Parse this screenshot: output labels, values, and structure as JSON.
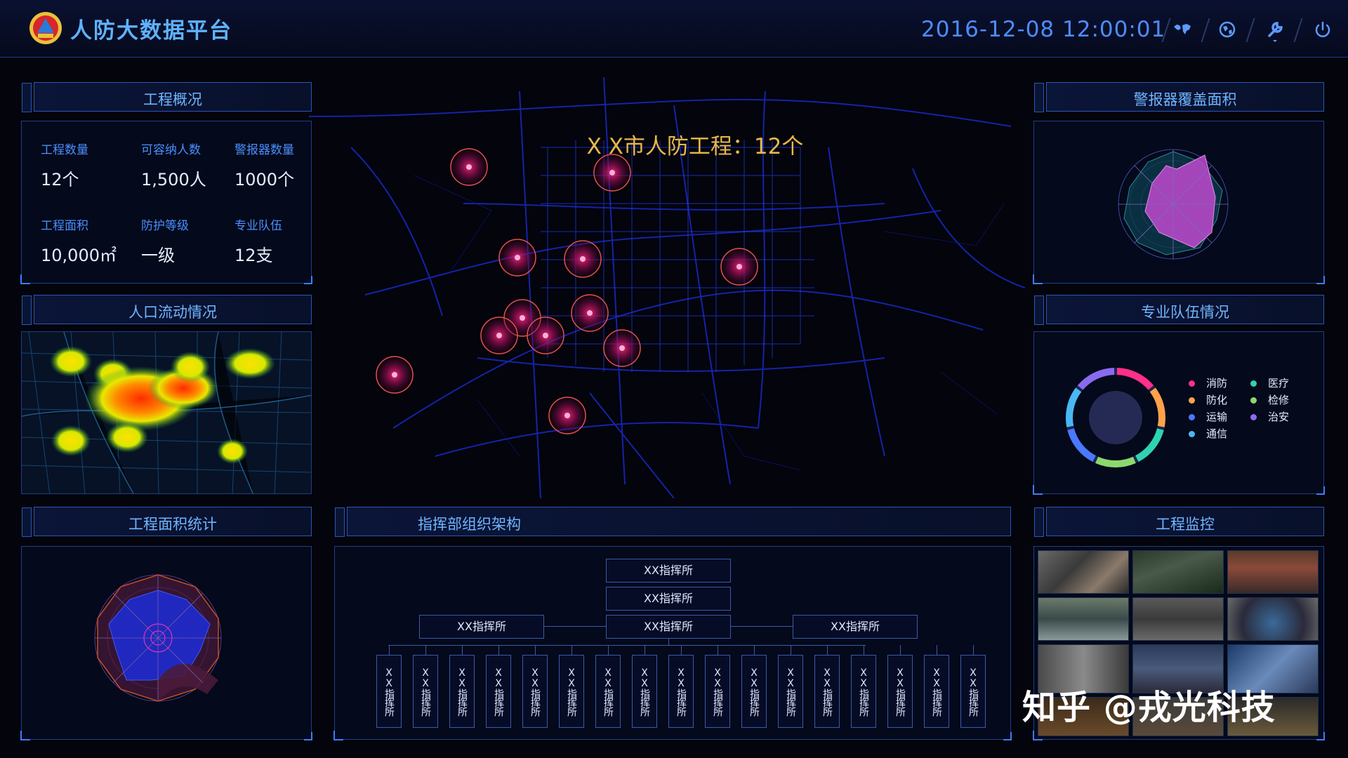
{
  "app": {
    "title": "人防大数据平台",
    "datetime": "2016-12-08 12:00:01",
    "accent_color": "#4d8cff",
    "toolbar_icons": [
      "world-map-icon",
      "globe-icon",
      "wrench-icon",
      "power-icon"
    ]
  },
  "overview": {
    "title": "工程概况",
    "stats": [
      {
        "label": "工程数量",
        "value": "12个"
      },
      {
        "label": "可容纳人数",
        "value": "1,500人"
      },
      {
        "label": "警报器数量",
        "value": "1000个"
      },
      {
        "label": "工程面积",
        "value": "10,000㎡"
      },
      {
        "label": "防护等级",
        "value": "一级"
      },
      {
        "label": "专业队伍",
        "value": "12支"
      }
    ]
  },
  "population": {
    "title": "人口流动情况"
  },
  "area_stats": {
    "title": "工程面积统计"
  },
  "map": {
    "title": "X X市人防工程：12个",
    "marker_color": "#ff2a86"
  },
  "org": {
    "title": "指挥部组织架构",
    "top": [
      "XX指挥所",
      "XX指挥所"
    ],
    "middle": [
      "XX指挥所",
      "XX指挥所",
      "XX指挥所"
    ],
    "bottom": [
      "XX指挥所",
      "XX指挥所",
      "XX指挥所",
      "XX指挥所",
      "XX指挥所",
      "XX指挥所",
      "XX指挥所",
      "XX指挥所",
      "XX指挥所",
      "XX指挥所",
      "XX指挥所",
      "XX指挥所",
      "XX指挥所",
      "XX指挥所",
      "XX指挥所",
      "XX指挥所",
      "XX指挥所"
    ]
  },
  "alarm": {
    "title": "警报器覆盖面积"
  },
  "team": {
    "title": "专业队伍情况",
    "legend": [
      {
        "label": "消防",
        "color": "#ff2f8a"
      },
      {
        "label": "医疗",
        "color": "#2ed3b0"
      },
      {
        "label": "防化",
        "color": "#ffa24a"
      },
      {
        "label": "检修",
        "color": "#8cd86e"
      },
      {
        "label": "运输",
        "color": "#4a78ff"
      },
      {
        "label": "治安",
        "color": "#8a6bf0"
      },
      {
        "label": "通信",
        "color": "#49b8f5"
      }
    ]
  },
  "monitor": {
    "title": "工程监控"
  },
  "watermark": "知乎 @戎光科技"
}
